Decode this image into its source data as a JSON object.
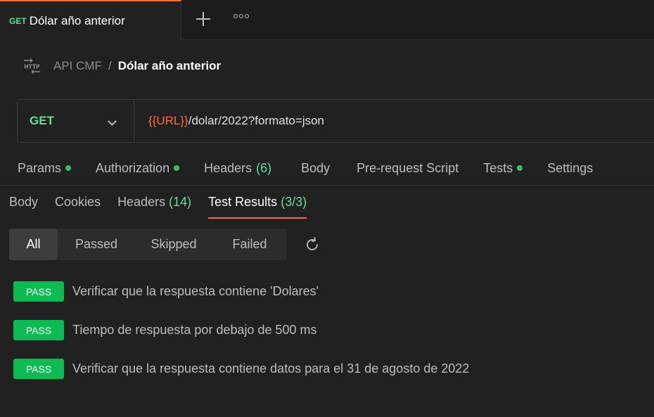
{
  "tab": {
    "method": "GET",
    "title": "Dólar año anterior"
  },
  "breadcrumb": {
    "collection": "API CMF",
    "separator": "/",
    "request": "Dólar año anterior"
  },
  "request": {
    "method": "GET",
    "url_var": "{{URL}}",
    "url_path": "/dolar/2022?formato=json"
  },
  "request_tabs": [
    {
      "label": "Params",
      "dot": true
    },
    {
      "label": "Authorization",
      "dot": true
    },
    {
      "label": "Headers",
      "count": "(6)"
    },
    {
      "label": "Body"
    },
    {
      "label": "Pre-request Script"
    },
    {
      "label": "Tests",
      "dot": true
    },
    {
      "label": "Settings"
    }
  ],
  "response_tabs": [
    {
      "label": "Body"
    },
    {
      "label": "Cookies"
    },
    {
      "label": "Headers",
      "count": "(14)"
    },
    {
      "label": "Test Results",
      "count": "(3/3)",
      "active": true
    }
  ],
  "filters": [
    "All",
    "Passed",
    "Skipped",
    "Failed"
  ],
  "active_filter": "All",
  "results": [
    {
      "status": "PASS",
      "text": "Verificar que la respuesta contiene 'Dolares'"
    },
    {
      "status": "PASS",
      "text": "Tiempo de respuesta por debajo de 500 ms"
    },
    {
      "status": "PASS",
      "text": "Verificar que la respuesta contiene datos para el 31 de agosto de 2022"
    }
  ],
  "icons": {
    "protocol": "http-icon",
    "add": "plus-icon",
    "more": "more-icon",
    "dropdown": "chevron-down-icon",
    "refresh": "refresh-icon"
  },
  "colors": {
    "accent": "#ff6c37",
    "get": "#6bdd9a",
    "pass": "#0cbb52",
    "dot": "#3cbf66"
  }
}
